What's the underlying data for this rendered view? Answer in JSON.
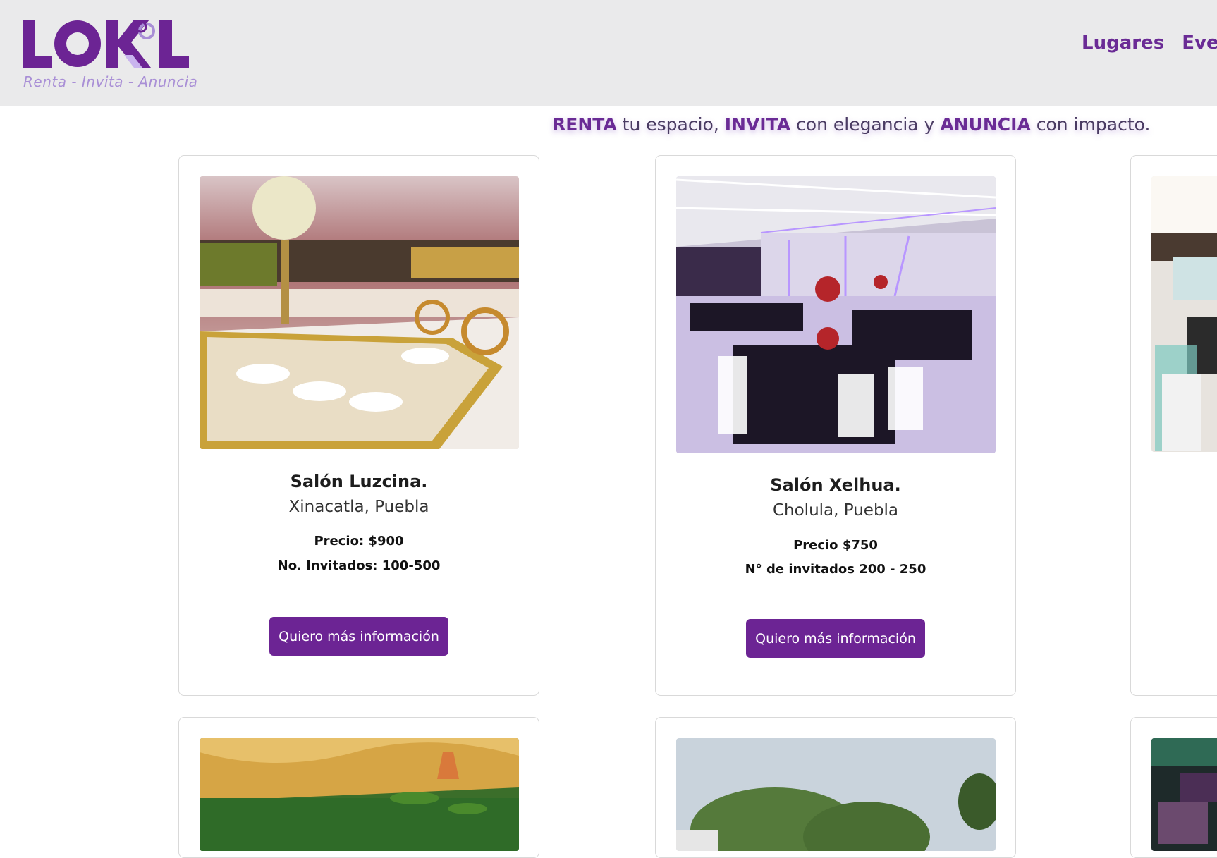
{
  "brand": {
    "logo_text": "LOK'L",
    "tagline": "Renta - Invita - Anuncia",
    "colors": {
      "primary": "#6c2494",
      "light_purple": "#a98fd6",
      "header_bg": "#eaeaeb"
    }
  },
  "nav": {
    "items": [
      {
        "label": "Lugares"
      },
      {
        "label": "Event"
      }
    ]
  },
  "hero": {
    "part1_bold": "RENTA",
    "part1": " tu espacio, ",
    "part2_bold": "INVITA",
    "part2": " con elegancia y ",
    "part3_bold": "ANUNCIA",
    "part3": " con impacto."
  },
  "venues": [
    {
      "name": "Salón Luzcina.",
      "location": "Xinacatla, Puebla",
      "price": "Precio: $900",
      "guests": "No. Invitados: 100-500",
      "button": "Quiero más información",
      "image_icon": "banquet-hall-photo"
    },
    {
      "name": "Salón Xelhua.",
      "location": "Cholula, Puebla",
      "price": "Precio $750",
      "guests": "N° de invitados 200 - 250",
      "button": "Quiero más información",
      "image_icon": "banquet-hall-photo"
    }
  ]
}
